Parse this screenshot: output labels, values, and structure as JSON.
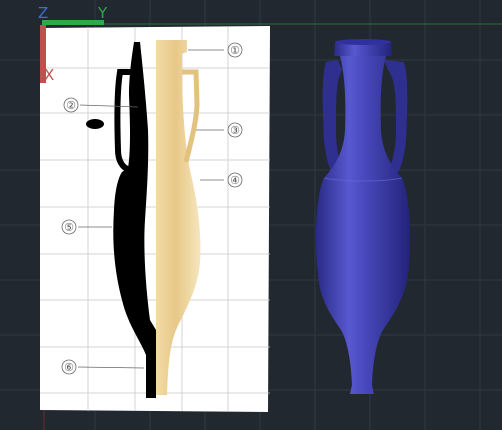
{
  "ucs": {
    "z_label": "Z",
    "y_label": "Y",
    "x_label": "X",
    "z_color": "#3a6fd8",
    "y_color": "#2fa84a",
    "x_color": "#c0504d"
  },
  "reference_drawing": {
    "callouts": [
      {
        "number": "①"
      },
      {
        "number": "②"
      },
      {
        "number": "③"
      },
      {
        "number": "④"
      },
      {
        "number": "⑤"
      },
      {
        "number": "⑥"
      }
    ],
    "profile_color": "#000000",
    "amphora_color": "#e6c987"
  },
  "model_3d": {
    "shape": "amphora",
    "color": "#3c3ca8"
  },
  "colors": {
    "background": "#212830",
    "grid": "#2e3742"
  }
}
